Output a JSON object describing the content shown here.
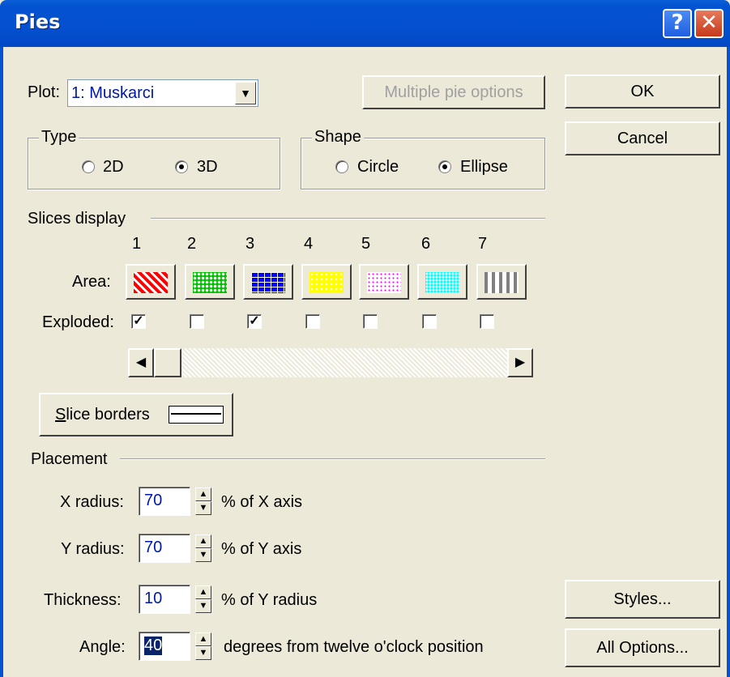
{
  "window": {
    "title": "Pies",
    "help_icon": "?",
    "close_icon": "✕"
  },
  "plot": {
    "label": "Plot:",
    "value": "1: Muskarci"
  },
  "buttons": {
    "multiple": "Multiple pie options",
    "ok": "OK",
    "cancel": "Cancel",
    "styles": "Styles...",
    "all_options": "All Options..."
  },
  "type": {
    "legend": "Type",
    "options": [
      "2D",
      "3D"
    ],
    "selected": "3D"
  },
  "shape": {
    "legend": "Shape",
    "options": [
      "Circle",
      "Ellipse"
    ],
    "selected": "Ellipse"
  },
  "slices": {
    "legend": "Slices display",
    "numbers": [
      "1",
      "2",
      "3",
      "4",
      "5",
      "6",
      "7"
    ],
    "area_label": "Area:",
    "exploded_label": "Exploded:",
    "exploded": [
      true,
      false,
      true,
      false,
      false,
      false,
      false
    ],
    "colors": [
      "#FF0000",
      "#00C000",
      "#0000FF",
      "#FFFF00",
      "#FF00FF",
      "#00FFFF",
      "#808080"
    ]
  },
  "slice_borders": {
    "label": "Slice borders"
  },
  "placement": {
    "legend": "Placement",
    "x_radius": {
      "label": "X radius:",
      "value": "70",
      "unit": "% of X axis"
    },
    "y_radius": {
      "label": "Y radius:",
      "value": "70",
      "unit": "% of Y axis"
    },
    "thickness": {
      "label": "Thickness:",
      "value": "10",
      "unit": "% of Y radius"
    },
    "angle": {
      "label": "Angle:",
      "value": "40",
      "unit": "degrees from twelve o'clock position"
    }
  }
}
